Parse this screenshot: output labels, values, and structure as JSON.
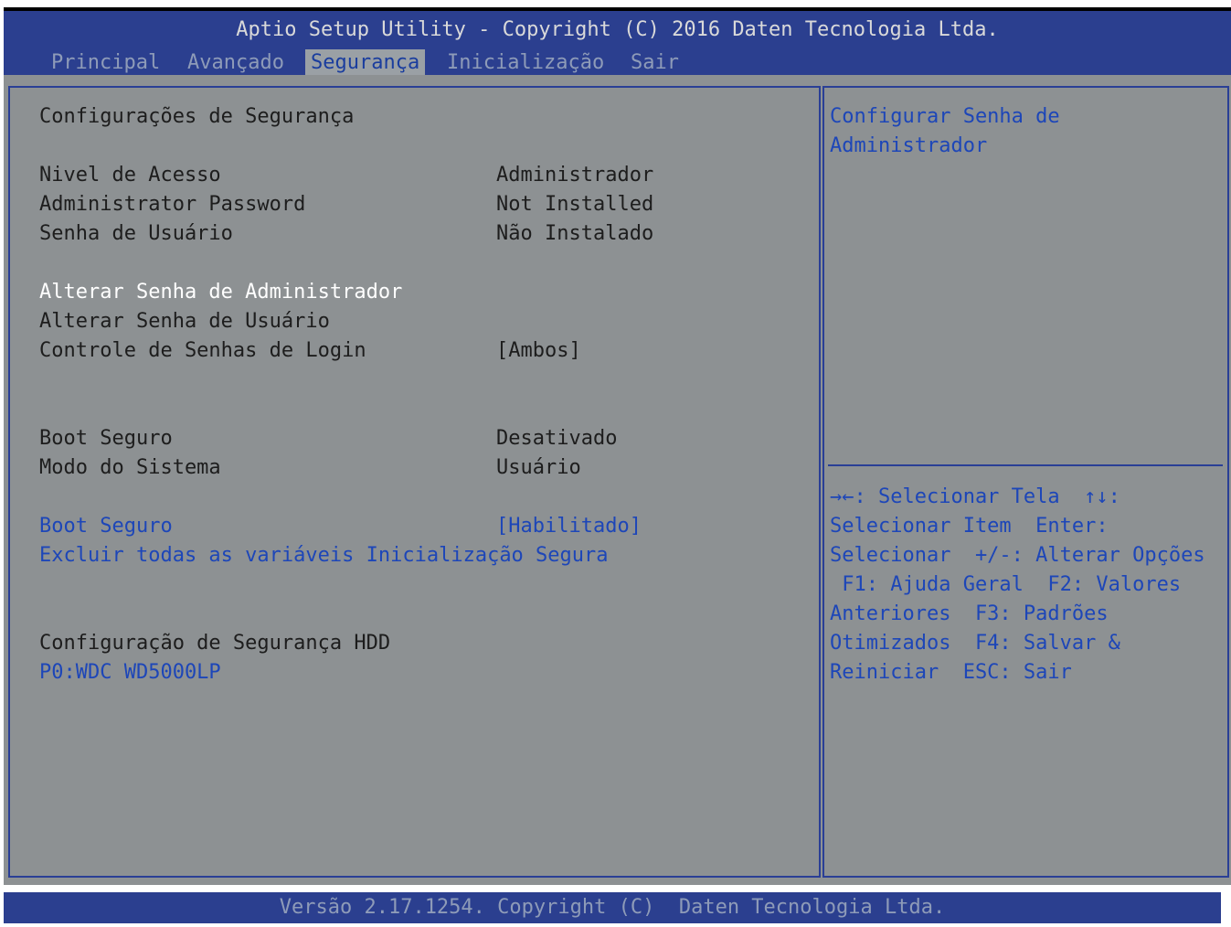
{
  "header": {
    "title": "Aptio Setup Utility - Copyright (C) 2016 Daten Tecnologia Ltda.",
    "tabs": [
      {
        "label": "Principal"
      },
      {
        "label": "Avançado"
      },
      {
        "label": "Segurança"
      },
      {
        "label": "Inicialização"
      },
      {
        "label": "Sair"
      }
    ],
    "active_tab": "Segurança"
  },
  "main": {
    "section_title": "Configurações de Segurança",
    "info": [
      {
        "label": "Nivel de Acesso",
        "value": "Administrador"
      },
      {
        "label": "Administrator Password",
        "value": "Not Installed"
      },
      {
        "label": "Senha de Usuário",
        "value": "Não Instalado"
      }
    ],
    "actions": [
      {
        "label": "Alterar Senha de Administrador"
      },
      {
        "label": "Alterar Senha de Usuário"
      },
      {
        "label": "Controle de Senhas de Login",
        "value": "[Ambos]"
      }
    ],
    "secure_boot_info": [
      {
        "label": "Boot Seguro",
        "value": "Desativado"
      },
      {
        "label": "Modo do Sistema",
        "value": "Usuário"
      }
    ],
    "secure_boot_options": [
      {
        "label": "Boot Seguro",
        "value": "[Habilitado]"
      },
      {
        "label": "Excluir todas as variáveis Inicialização Segura"
      }
    ],
    "hdd_title": "Configuração de Segurança HDD",
    "hdd_item": "P0:WDC WD5000LP"
  },
  "help": {
    "description": [
      "Configurar Senha de",
      "Administrador"
    ],
    "keys": [
      "→←: Selecionar Tela  ↑↓:",
      "Selecionar Item  Enter:",
      "Selecionar  +/-: Alterar Opções",
      " F1: Ajuda Geral  F2: Valores",
      "Anteriores  F3: Padrões",
      "Otimizados  F4: Salvar &",
      "Reiniciar  ESC: Sair"
    ]
  },
  "footer": {
    "text": "Versão 2.17.1254. Copyright (C)  Daten Tecnologia Ltda."
  },
  "colors": {
    "header_bg": "#2b3f8f",
    "panel_bg": "#8d9193",
    "selectable_blue": "#1d46b8",
    "highlight_white": "#ffffff"
  }
}
